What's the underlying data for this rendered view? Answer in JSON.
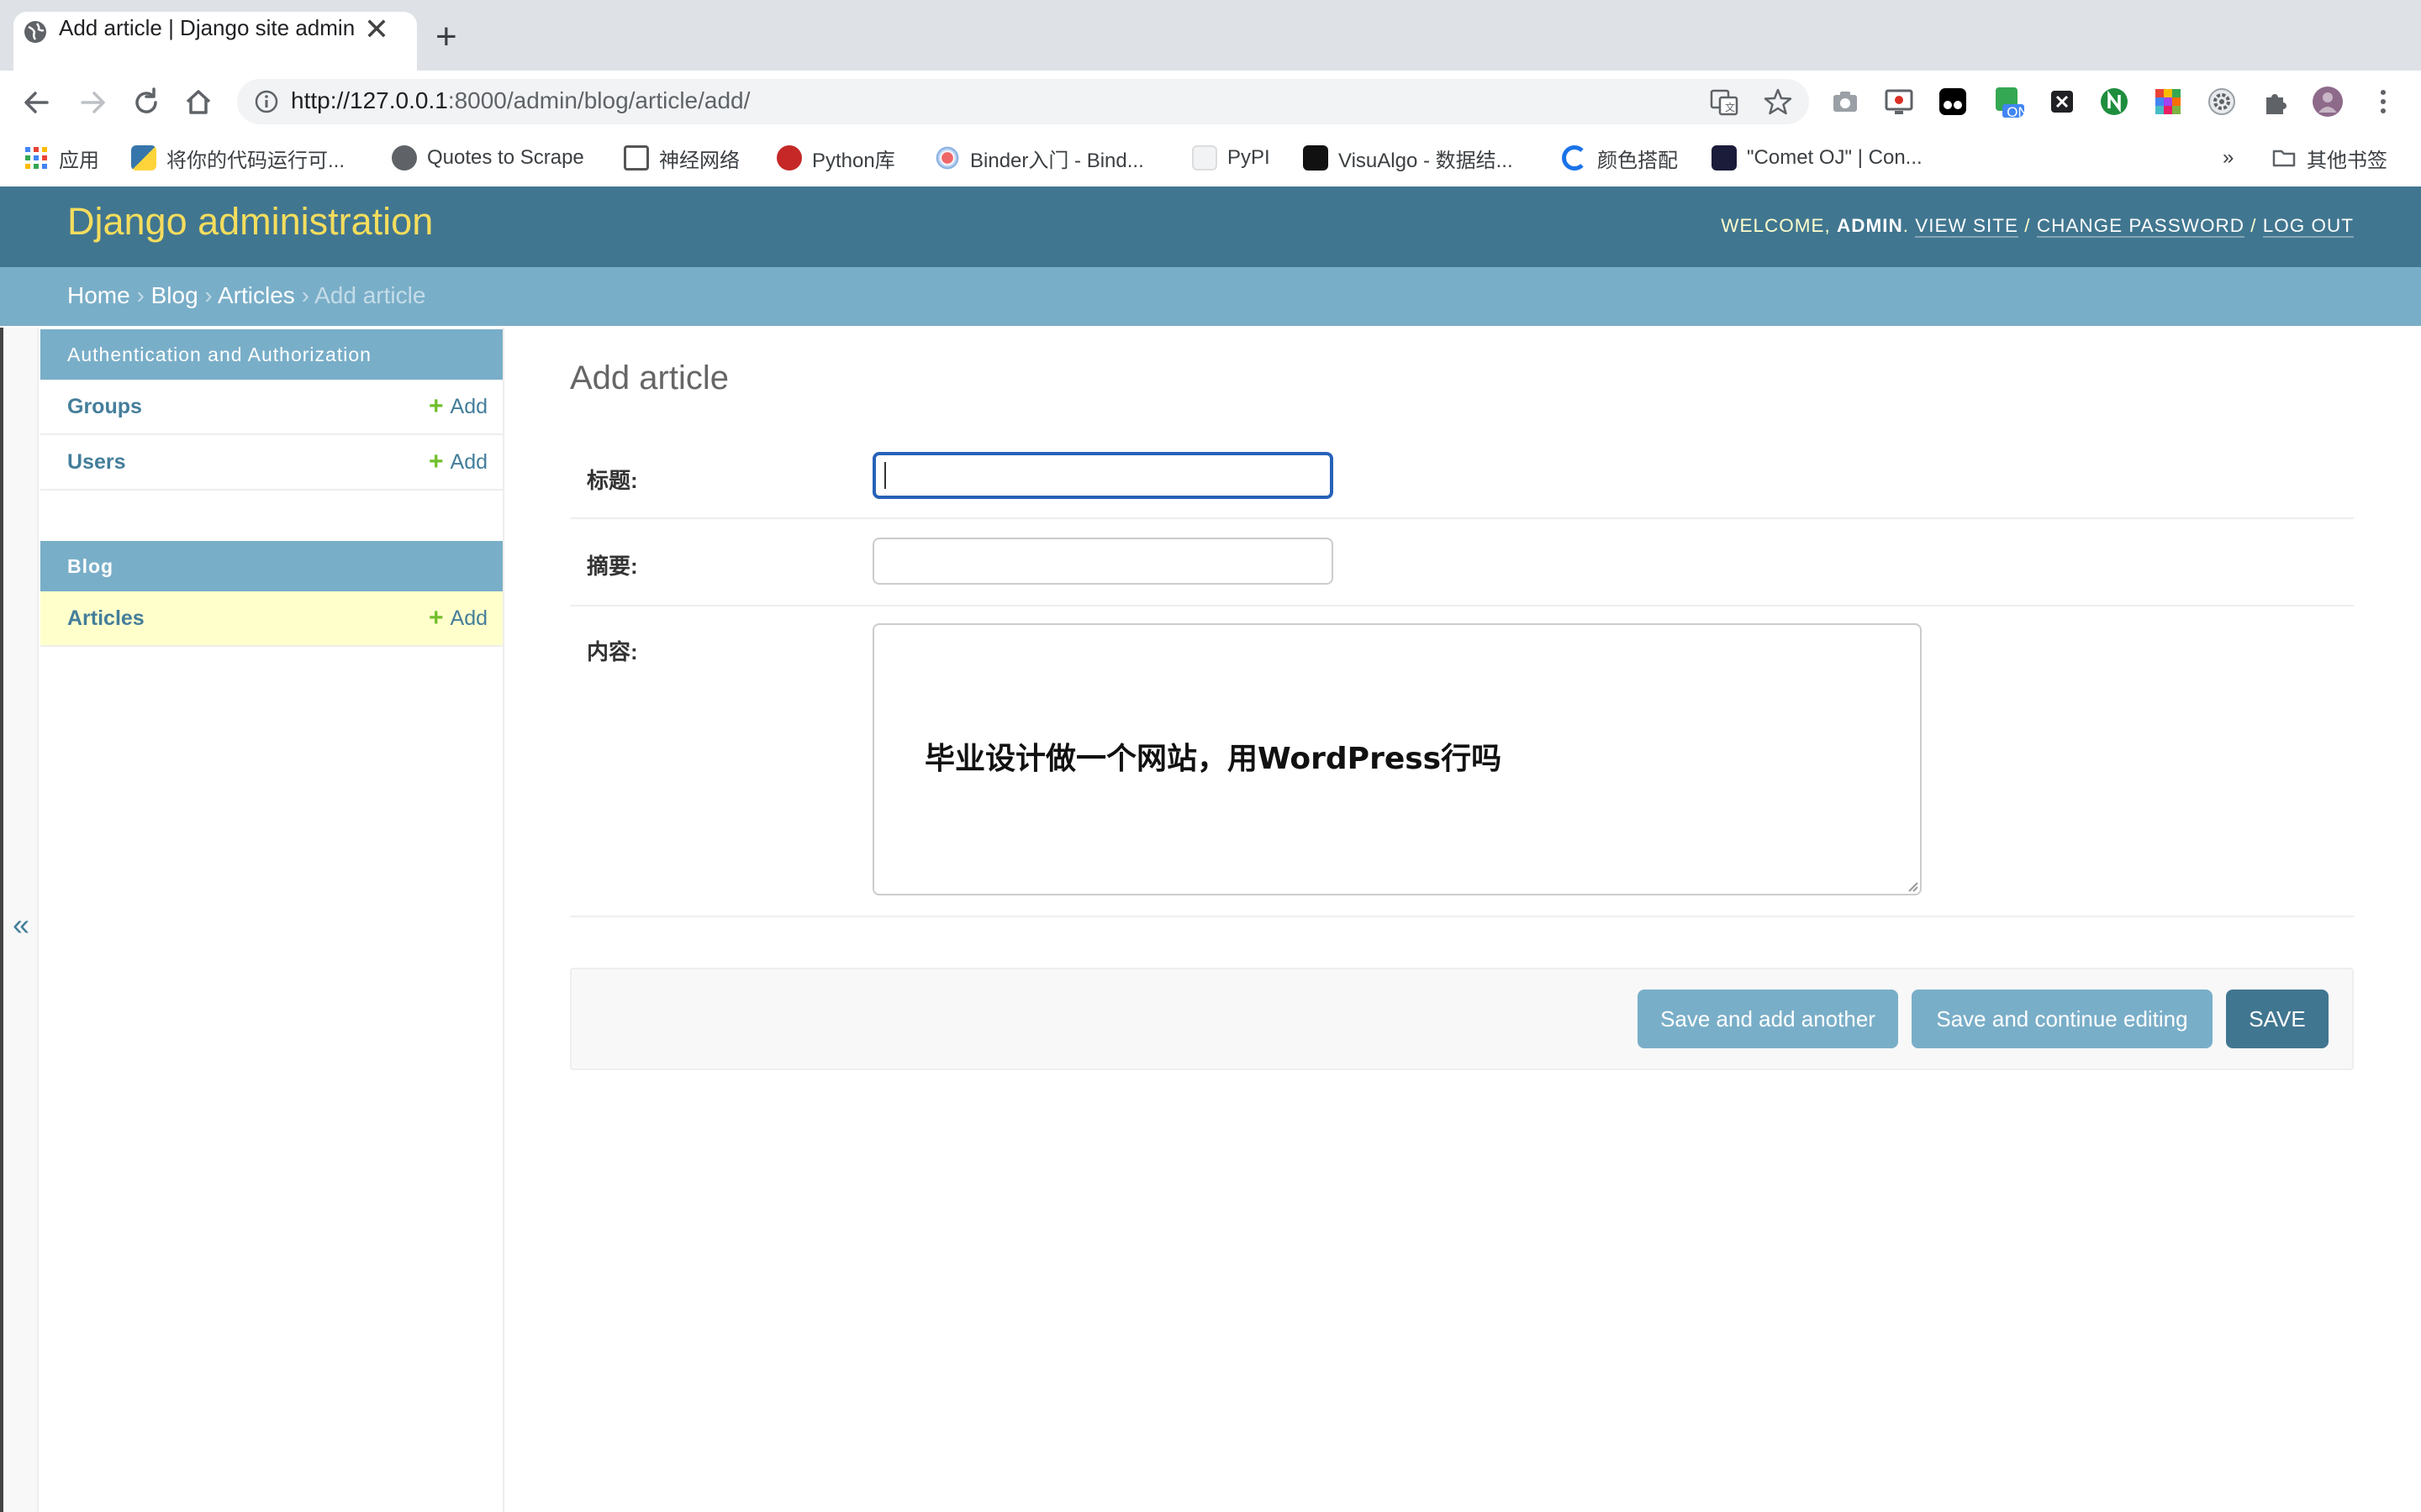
{
  "browser": {
    "tab_title": "Add article | Django site admin",
    "tab_close": "✕",
    "new_tab": "+",
    "url_host": "http://127.0.0.1",
    "url_rest": ":8000/admin/blog/article/add/",
    "bookmarks": {
      "apps": "应用",
      "b1": "将你的代码运行可...",
      "b2": "Quotes to Scrape",
      "b3": "神经网络",
      "b4": "Python库",
      "b5": "Binder入门 - Bind...",
      "b6": "PyPI",
      "b7": "VisuAlgo - 数据结...",
      "b8": "颜色搭配",
      "b9": "\"Comet OJ\" | Con...",
      "more": "»",
      "other": "其他书签"
    },
    "ext_badge": "ON"
  },
  "header": {
    "branding": "Django administration",
    "welcome": "Welcome,",
    "user": "admin",
    "view_site": "View site",
    "change_password": "Change password",
    "log_out": "Log out",
    "sep": "/"
  },
  "breadcrumbs": {
    "home": "Home",
    "blog": "Blog",
    "articles": "Articles",
    "current": "Add article",
    "sep": "›"
  },
  "sidebar": {
    "collapse": "«",
    "auth_caption": "Authentication and Authorization",
    "groups": "Groups",
    "users": "Users",
    "blog_caption": "Blog",
    "articles": "Articles",
    "add": "Add",
    "plus": "+"
  },
  "form": {
    "title": "Add article",
    "title_label": "标题:",
    "summary_label": "摘要:",
    "content_label": "内容:",
    "overlay_text": "毕业设计做一个网站，用WordPress行吗"
  },
  "actions": {
    "save_add_another": "Save and add another",
    "save_continue": "Save and continue editing",
    "save": "Save"
  },
  "colors": {
    "header": "#417690",
    "breadcrumbs": "#79aec8",
    "branding": "#f5dd5d",
    "selected_row": "#ffffcc",
    "add_plus": "#70bf2b"
  }
}
